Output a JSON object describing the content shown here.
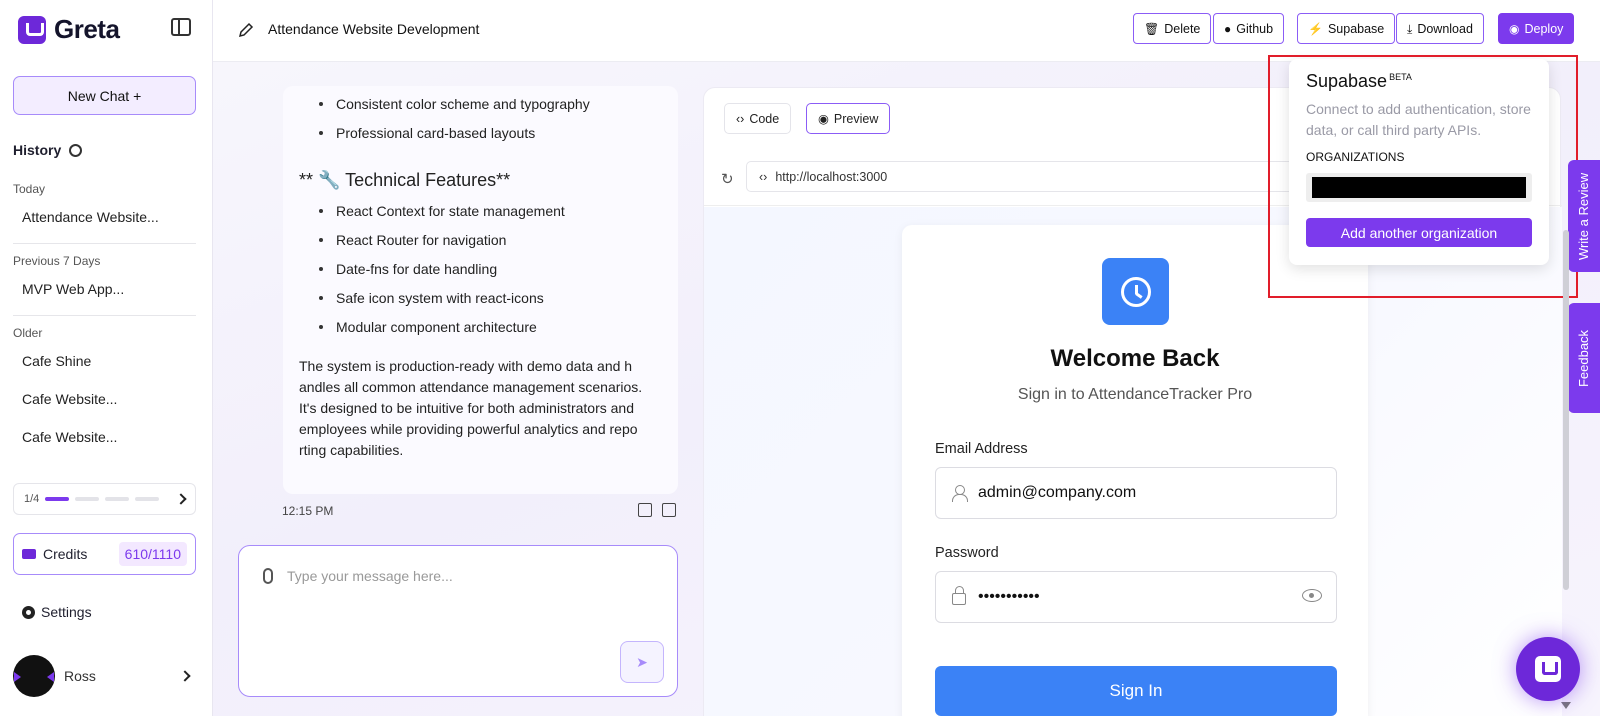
{
  "app": {
    "name": "Greta"
  },
  "sidebar": {
    "new_chat": "New Chat +",
    "history_label": "History",
    "groups": [
      {
        "label": "Today",
        "items": [
          "Attendance Website..."
        ]
      },
      {
        "label": "Previous 7 Days",
        "items": [
          "MVP Web App..."
        ]
      },
      {
        "label": "Older",
        "items": [
          "Cafe Shine",
          "Cafe Website...",
          "Cafe Website..."
        ]
      }
    ],
    "pager": {
      "text": "1/4",
      "current": 1,
      "total": 4
    },
    "credits": {
      "label": "Credits",
      "value": "610/1110"
    },
    "settings": "Settings",
    "user": {
      "name": "Ross"
    }
  },
  "header": {
    "project_title": "Attendance Website Development",
    "buttons": [
      {
        "label": "Delete",
        "icon": "trash-icon"
      },
      {
        "label": "Github",
        "icon": "github-icon"
      },
      {
        "label": "Supabase",
        "icon": "bolt-icon"
      },
      {
        "label": "Download",
        "icon": "download-icon"
      },
      {
        "label": "Deploy",
        "icon": "deploy-icon"
      }
    ]
  },
  "chat": {
    "bullets_top": [
      "Consistent color scheme and typography",
      "Professional card-based layouts"
    ],
    "features_heading": "** 🔧 Technical Features**",
    "features": [
      "React Context for state management",
      "React Router for navigation",
      "Date-fns for date handling",
      "Safe icon system with react-icons",
      "Modular component architecture"
    ],
    "summary_lines": [
      "The system is production-ready with demo data and h",
      "andles all common attendance management scenarios.",
      "It's designed to be intuitive for both administrators and",
      "employees while providing powerful analytics and repo",
      "rting capabilities."
    ],
    "timestamp": "12:15 PM",
    "composer_placeholder": "Type your message here..."
  },
  "preview": {
    "tabs": [
      {
        "label": "Code",
        "active": false
      },
      {
        "label": "Preview",
        "active": true
      }
    ],
    "url": "http://localhost:3000",
    "login": {
      "title": "Welcome Back",
      "subtitle": "Sign in to AttendanceTracker Pro",
      "email_label": "Email Address",
      "email_value": "admin@company.com",
      "password_label": "Password",
      "password_value": "•••••••••••",
      "submit": "Sign In"
    }
  },
  "supabase_popover": {
    "title": "Supabase",
    "badge": "BETA",
    "description": "Connect to add authentication, store data, or call third party APIs.",
    "organizations_label": "ORGANIZATIONS",
    "add_org": "Add another organization"
  },
  "side_tabs": {
    "review": "Write a Review",
    "feedback": "Feedback"
  },
  "colors": {
    "accent": "#7c3aed",
    "primary_blue": "#3b82f6",
    "highlight": "#e11d2a"
  }
}
